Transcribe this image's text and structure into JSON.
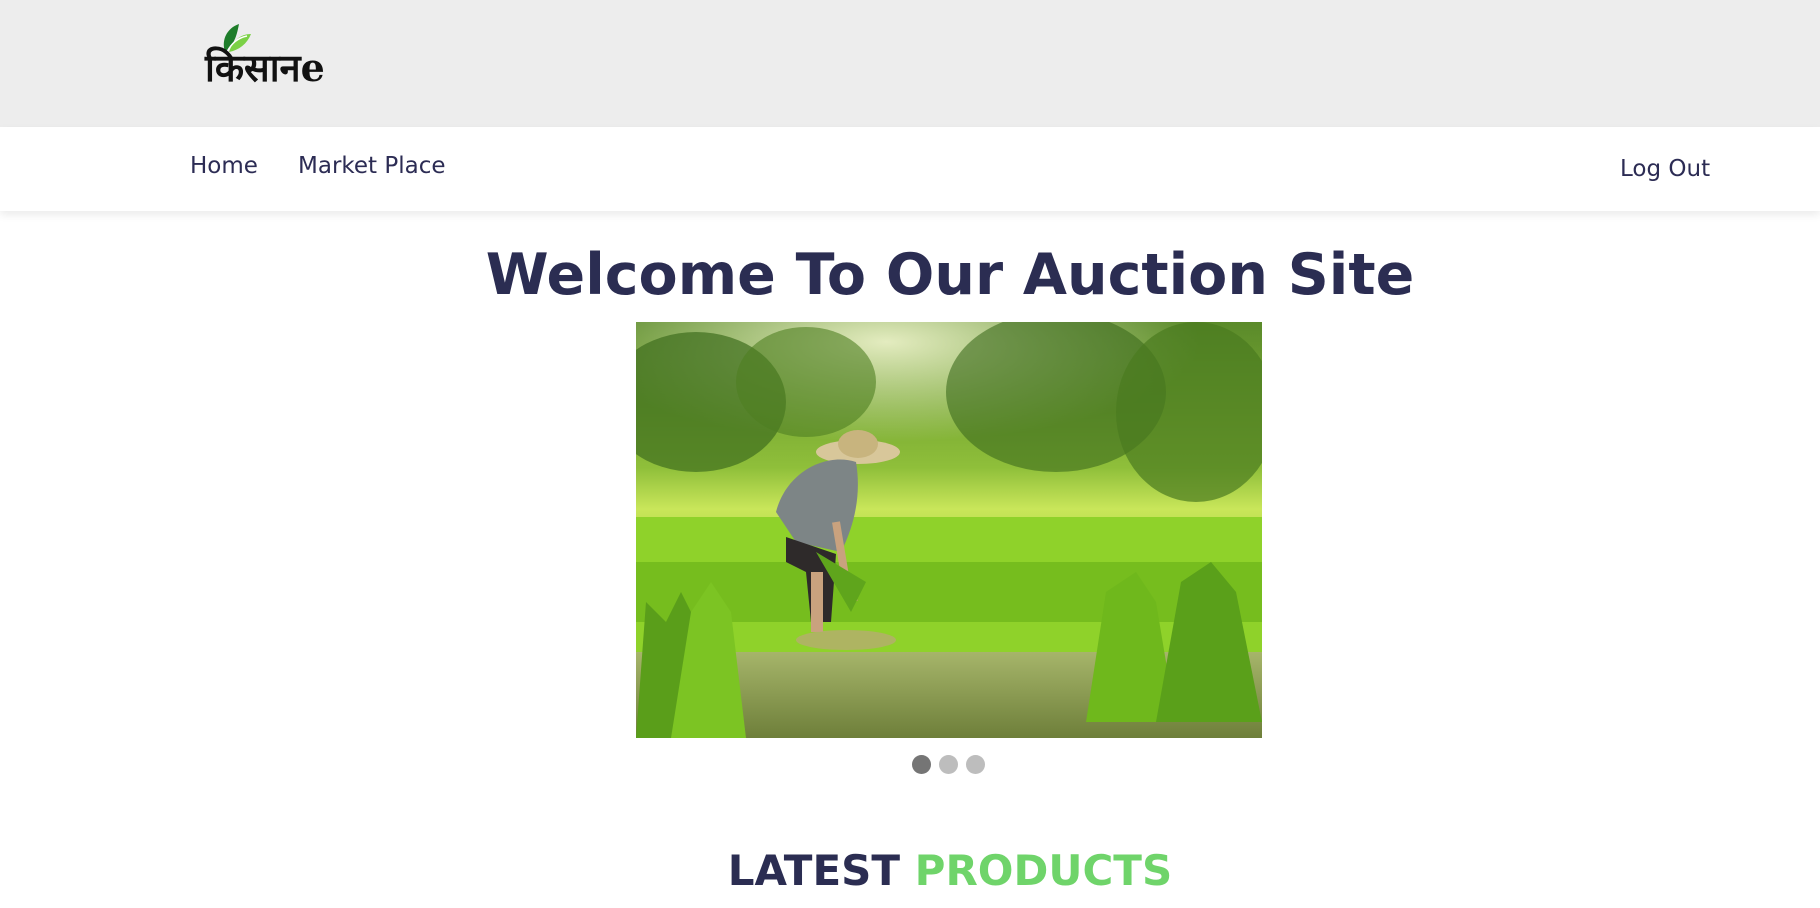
{
  "header": {
    "logo_text": "किसानe"
  },
  "nav": {
    "home": "Home",
    "market_place": "Market Place",
    "log_out": "Log Out"
  },
  "hero": {
    "title": "Welcome To Our Auction Site",
    "carousel": {
      "slide_count": 3,
      "active_index": 0,
      "image_alt": "farmer planting rice seedlings in a green paddy field"
    }
  },
  "latest": {
    "title_part1": "LATEST",
    "title_part2": "PRODUCTS"
  },
  "colors": {
    "topbar_bg": "#ededed",
    "nav_text": "#2c2c54",
    "heading": "#2b2d52",
    "accent_green": "#6fd46a",
    "dot_active": "#757575",
    "dot_inactive": "#bdbdbd"
  },
  "icons": {
    "logo_leaf": "leaf-icon"
  }
}
